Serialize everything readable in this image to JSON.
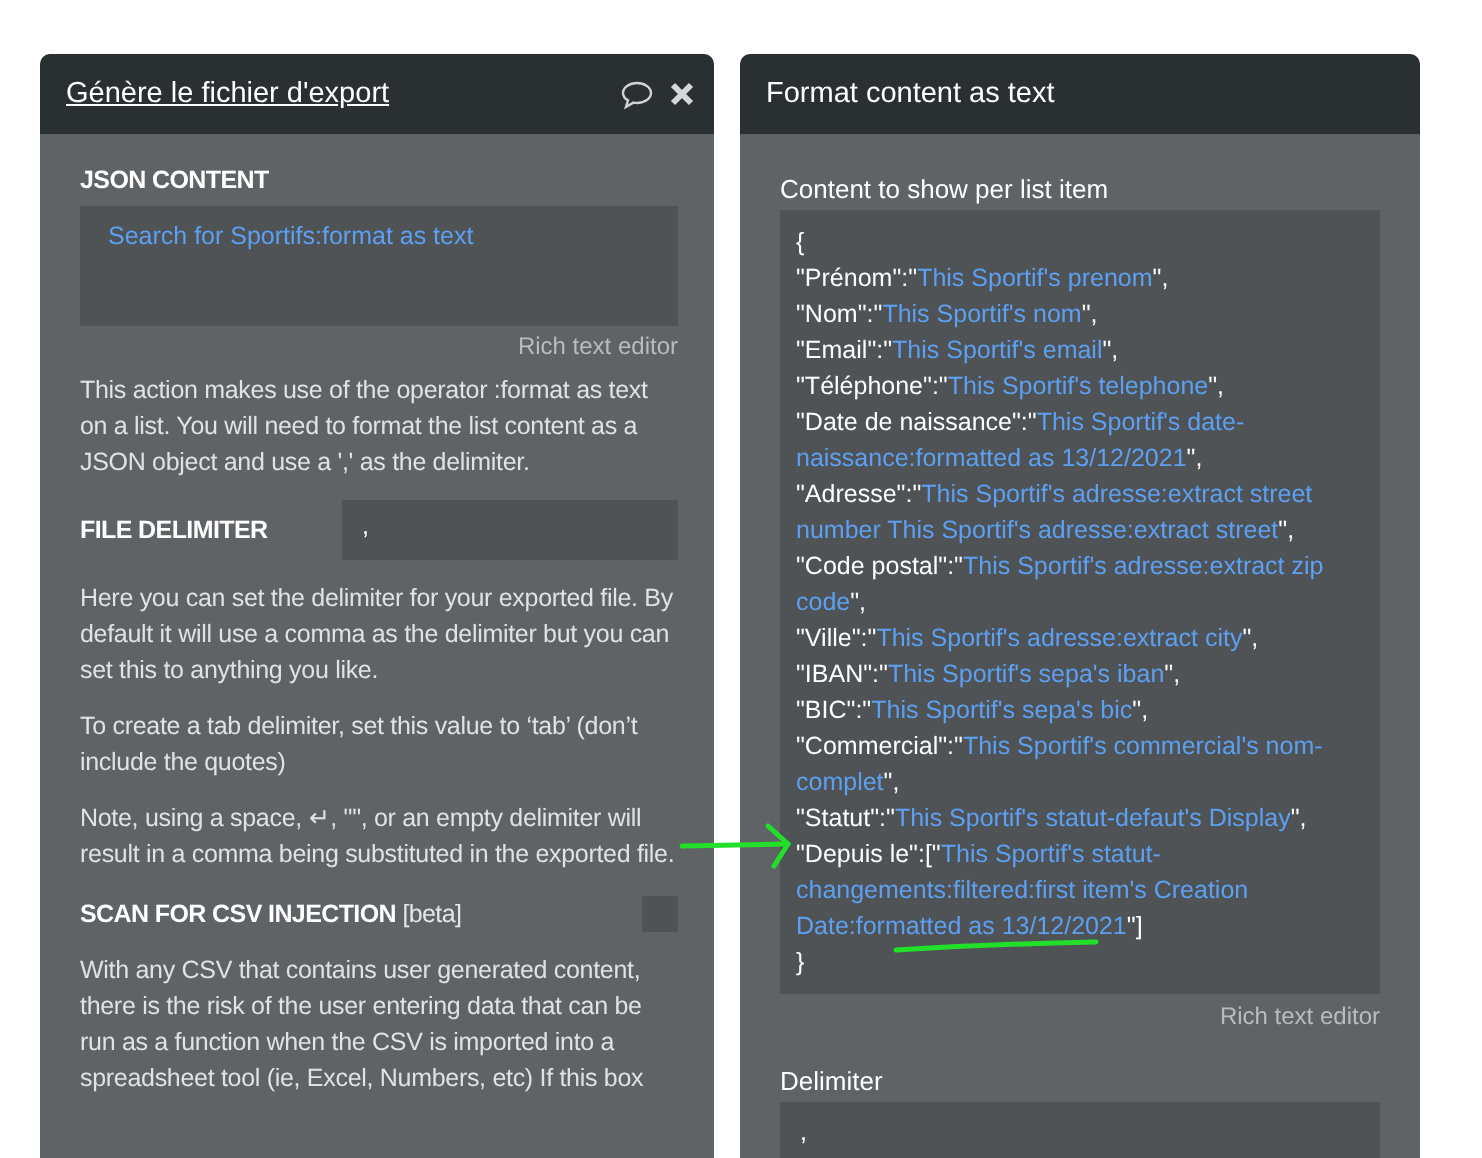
{
  "left_panel": {
    "title": "Génère le fichier d'export",
    "json_content": {
      "label": "JSON CONTENT",
      "value": "Search for Sportifs:format as text",
      "hint": "Rich text editor"
    },
    "intro": "This action makes use of the operator :format as text on a list. You will need to format the list content as a JSON object and use a ',' as the delimiter.",
    "file_delimiter": {
      "label": "FILE DELIMITER",
      "value": ","
    },
    "notes": [
      "Here you can set the delimiter for your exported file. By default it will use a comma as the delimiter but you can set this to anything you like.",
      "To create a tab delimiter, set this value to ‘tab’ (don’t include the quotes)",
      "Note, using a space, ↵, \"\", or an empty delimiter will result in a comma being substituted in the exported file."
    ],
    "csv_injection": {
      "label": "SCAN FOR CSV INJECTION",
      "tag": "[beta]",
      "checked": false
    },
    "csv_note": "With any CSV that contains user generated content, there is the risk of the user entering data that can be run as a function when the CSV is imported into a spreadsheet tool (ie, Excel, Numbers, etc) If this box"
  },
  "right_panel": {
    "title": "Format content as text",
    "content_label": "Content to show per list item",
    "content_lines": [
      [
        {
          "kind": "plain",
          "text": "{"
        }
      ],
      [
        {
          "kind": "plain",
          "text": "\"Prénom\":\""
        },
        {
          "kind": "dynamic",
          "text": "This Sportif's prenom"
        },
        {
          "kind": "plain",
          "text": "\","
        }
      ],
      [
        {
          "kind": "plain",
          "text": "\"Nom\":\""
        },
        {
          "kind": "dynamic",
          "text": "This Sportif's nom"
        },
        {
          "kind": "plain",
          "text": "\","
        }
      ],
      [
        {
          "kind": "plain",
          "text": "\"Email\":\""
        },
        {
          "kind": "dynamic",
          "text": "This Sportif's email"
        },
        {
          "kind": "plain",
          "text": "\","
        }
      ],
      [
        {
          "kind": "plain",
          "text": "\"Téléphone\":\""
        },
        {
          "kind": "dynamic",
          "text": "This Sportif's telephone"
        },
        {
          "kind": "plain",
          "text": "\","
        }
      ],
      [
        {
          "kind": "plain",
          "text": "\"Date de naissance\":\""
        },
        {
          "kind": "dynamic",
          "text": "This Sportif's date-naissance:formatted as 13/12/2021"
        },
        {
          "kind": "plain",
          "text": "\","
        }
      ],
      [
        {
          "kind": "plain",
          "text": "\"Adresse\":\""
        },
        {
          "kind": "dynamic",
          "text": "This Sportif's adresse:extract street number This Sportif's adresse:extract street"
        },
        {
          "kind": "plain",
          "text": "\","
        }
      ],
      [
        {
          "kind": "plain",
          "text": "\"Code postal\":\""
        },
        {
          "kind": "dynamic",
          "text": "This Sportif's adresse:extract zip code"
        },
        {
          "kind": "plain",
          "text": "\","
        }
      ],
      [
        {
          "kind": "plain",
          "text": "\"Ville\":\""
        },
        {
          "kind": "dynamic",
          "text": "This Sportif's adresse:extract city"
        },
        {
          "kind": "plain",
          "text": "\","
        }
      ],
      [
        {
          "kind": "plain",
          "text": "\"IBAN\":\""
        },
        {
          "kind": "dynamic",
          "text": "This Sportif's sepa's iban"
        },
        {
          "kind": "plain",
          "text": "\","
        }
      ],
      [
        {
          "kind": "plain",
          "text": "\"BIC\":\""
        },
        {
          "kind": "dynamic",
          "text": "This Sportif's sepa's bic"
        },
        {
          "kind": "plain",
          "text": "\","
        }
      ],
      [
        {
          "kind": "plain",
          "text": "\"Commercial\":\""
        },
        {
          "kind": "dynamic",
          "text": "This Sportif's commercial's nom-complet"
        },
        {
          "kind": "plain",
          "text": "\","
        }
      ],
      [
        {
          "kind": "plain",
          "text": "\"Statut\":\""
        },
        {
          "kind": "dynamic",
          "text": "This Sportif's statut-defaut's Display"
        },
        {
          "kind": "plain",
          "text": "\","
        }
      ],
      [
        {
          "kind": "plain",
          "text": "\"Depuis le\":[\""
        },
        {
          "kind": "dynamic",
          "text": "This Sportif's statut-changements:filtered:first item's Creation Date:formatted as 13/12/2021"
        },
        {
          "kind": "plain",
          "text": "\"]"
        }
      ],
      [
        {
          "kind": "plain",
          "text": "}"
        }
      ]
    ],
    "content_hint": "Rich text editor",
    "delimiter_label": "Delimiter",
    "delimiter_value": ","
  }
}
